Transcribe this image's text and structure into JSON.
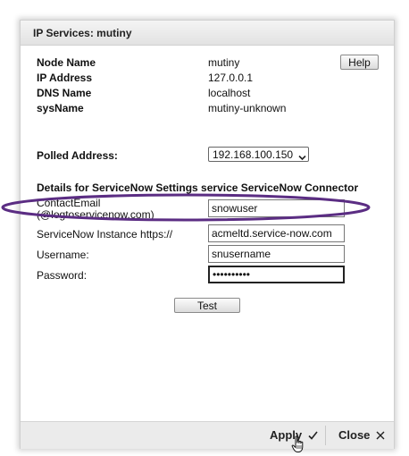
{
  "dialog": {
    "title": "IP Services: mutiny",
    "help_label": "Help"
  },
  "node_info": [
    {
      "label": "Node Name",
      "value": "mutiny"
    },
    {
      "label": "IP Address",
      "value": "127.0.0.1"
    },
    {
      "label": "DNS Name",
      "value": "localhost"
    },
    {
      "label": "sysName",
      "value": "mutiny-unknown"
    }
  ],
  "polled": {
    "label": "Polled Address:",
    "selected": "192.168.100.150",
    "chevron_icon": "chevron-down-icon"
  },
  "settings": {
    "heading": "Details for ServiceNow Settings service ServiceNow Connector",
    "fields": [
      {
        "label": "ContactEmail",
        "sublabel": "(@logtoservicenow.com)",
        "value": "snowuser"
      },
      {
        "label": "ServiceNow Instance https://",
        "value": "acmeltd.service-now.com"
      },
      {
        "label": "Username:",
        "value": "snusername"
      },
      {
        "label": "Password:",
        "value": "••••••••••"
      }
    ],
    "test_label": "Test"
  },
  "footer": {
    "apply_label": "Apply",
    "apply_icon": "checkmark-icon",
    "close_label": "Close",
    "close_icon": "close-icon"
  },
  "annotation": {
    "highlight_color": "#5b2d83"
  }
}
